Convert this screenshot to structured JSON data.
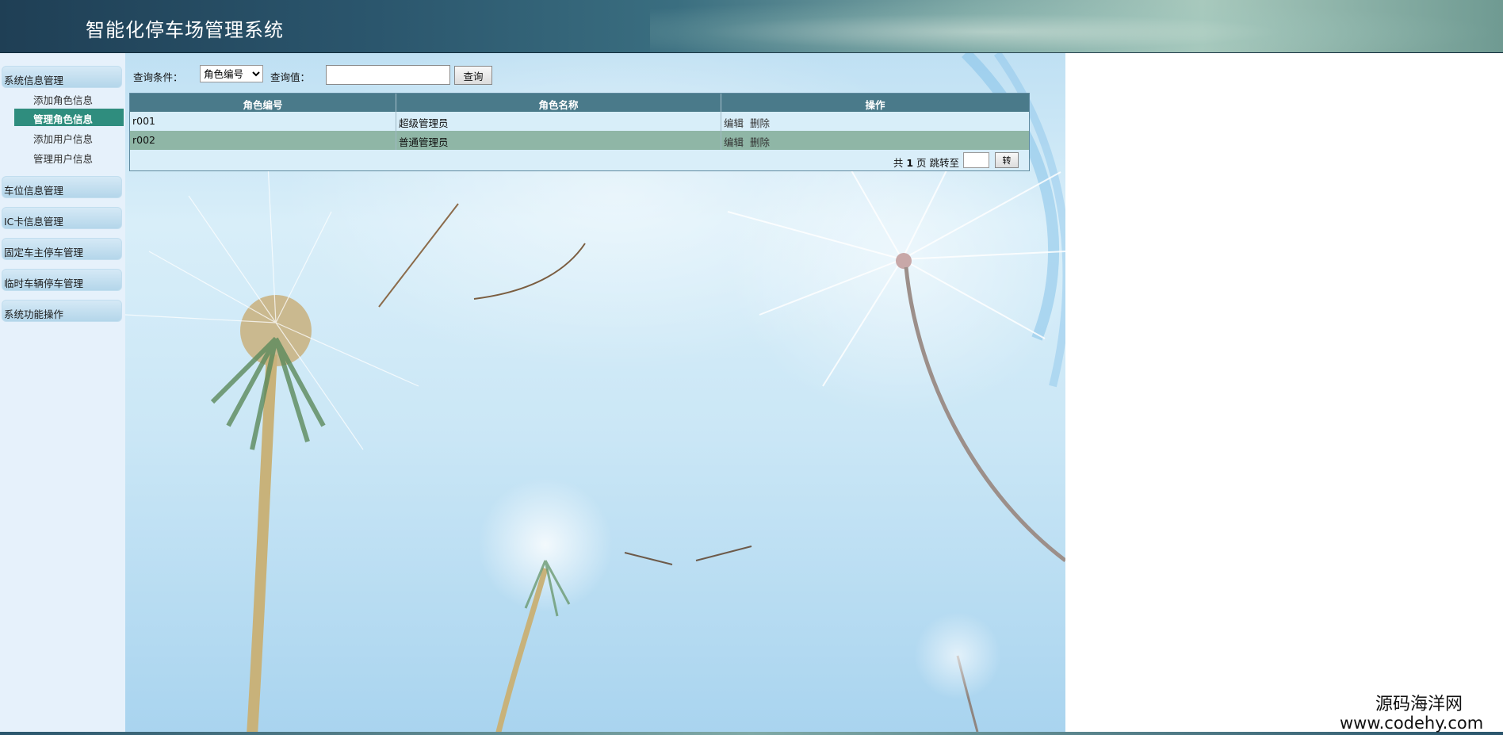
{
  "header": {
    "title": "智能化停车场管理系统"
  },
  "sidebar": {
    "groups": [
      {
        "label": "系统信息管理",
        "items": [
          {
            "label": "添加角色信息",
            "active": false
          },
          {
            "label": "管理角色信息",
            "active": true
          },
          {
            "label": "添加用户信息",
            "active": false
          },
          {
            "label": "管理用户信息",
            "active": false
          }
        ]
      },
      {
        "label": "车位信息管理"
      },
      {
        "label": "IC卡信息管理"
      },
      {
        "label": "固定车主停车管理"
      },
      {
        "label": "临时车辆停车管理"
      },
      {
        "label": "系统功能操作"
      }
    ]
  },
  "query": {
    "condition_label": "查询条件：",
    "condition_selected": "角色编号",
    "value_label": "查询值：",
    "value": "",
    "search_button": "查询"
  },
  "table": {
    "columns": [
      "角色编号",
      "角色名称",
      "操作"
    ],
    "rows": [
      {
        "id": "r001",
        "name": "超级管理员",
        "edit": "编辑",
        "delete": "删除"
      },
      {
        "id": "r002",
        "name": "普通管理员",
        "edit": "编辑",
        "delete": "删除"
      }
    ]
  },
  "pager": {
    "prefix": "共",
    "total_pages": "1",
    "middle": "页 跳转至",
    "jump_value": "",
    "go_button": "转"
  },
  "watermark": {
    "line1": "源码海洋网",
    "line2": "www.codehy.com"
  }
}
